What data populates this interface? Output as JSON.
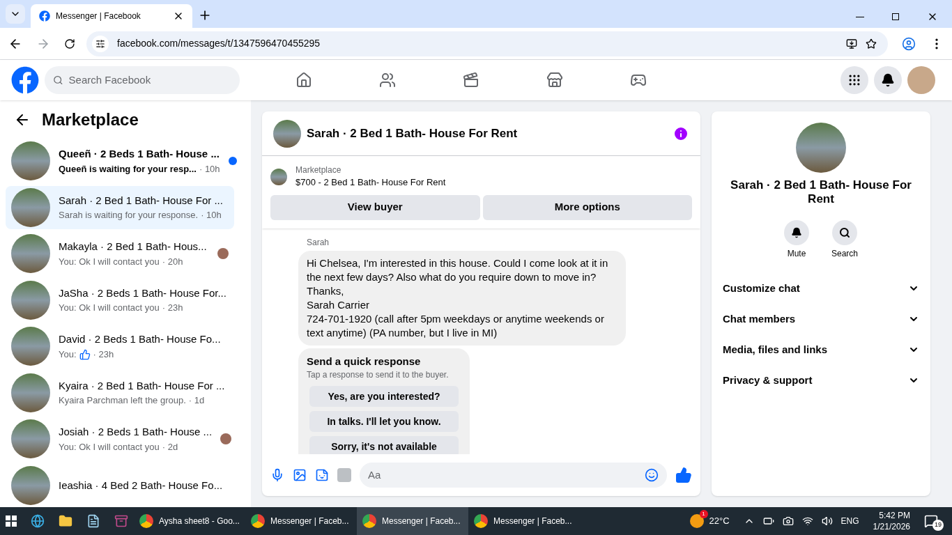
{
  "browser": {
    "tab_title": "Messenger | Facebook",
    "url": "facebook.com/messages/t/1347596470455295"
  },
  "header": {
    "search_placeholder": "Search Facebook"
  },
  "sidebar": {
    "title": "Marketplace",
    "conversations": [
      {
        "name": "Queeñ · 2 Beds 1 Bath- House ...",
        "preview": "Queeñ is waiting for your resp...",
        "time": "· 10h",
        "unread": true,
        "selected": false,
        "seen": false,
        "like": false
      },
      {
        "name": "Sarah · 2 Bed 1 Bath- House For ...",
        "preview": "Sarah is waiting for your response.",
        "time": "· 10h",
        "unread": false,
        "selected": true,
        "seen": false,
        "like": false
      },
      {
        "name": "Makayla · 2 Bed 1 Bath- Hous...",
        "preview": "You: Ok I will contact you",
        "time": "· 20h",
        "unread": false,
        "selected": false,
        "seen": true,
        "like": false
      },
      {
        "name": "JaSha · 2 Beds 1 Bath- House For...",
        "preview": "You: Ok I will contact you",
        "time": "· 23h",
        "unread": false,
        "selected": false,
        "seen": false,
        "like": false
      },
      {
        "name": "David · 2 Beds 1 Bath- House Fo...",
        "preview": "You:",
        "time": "· 23h",
        "unread": false,
        "selected": false,
        "seen": false,
        "like": true
      },
      {
        "name": "Kyaira · 2 Bed 1 Bath- House For ...",
        "preview": "Kyaira Parchman left the group.",
        "time": "· 1d",
        "unread": false,
        "selected": false,
        "seen": false,
        "like": false
      },
      {
        "name": "Josiah · 2 Beds 1 Bath- House ...",
        "preview": "You: Ok I will contact you",
        "time": "· 2d",
        "unread": false,
        "selected": false,
        "seen": true,
        "like": false
      },
      {
        "name": "Ieashia · 4 Bed 2 Bath- House Fo...",
        "unread": false,
        "selected": false,
        "seen": false,
        "like": false
      }
    ]
  },
  "chat": {
    "title": "Sarah · 2 Bed 1 Bath- House For Rent",
    "listing": {
      "label": "Marketplace",
      "title": "$700 - 2 Bed 1 Bath- House For Rent"
    },
    "buttons": [
      "View buyer",
      "More options"
    ],
    "sender": "Sarah",
    "message": "Hi Chelsea, I'm interested in this house. Could I come look at it in the next few days? Also what do you require down to move in?\nThanks,\nSarah Carrier\n724-701-1920 (call after 5pm weekdays or anytime weekends or text anytime) (PA number, but I live in MI)",
    "quick_response": {
      "title": "Send a quick response",
      "subtitle": "Tap a response to send it to the buyer.",
      "options": [
        "Yes, are you interested?",
        "In talks. I'll let you know.",
        "Sorry, it's not available"
      ]
    },
    "composer_placeholder": "Aa"
  },
  "info": {
    "name": "Sarah · 2 Bed 1 Bath- House For Rent",
    "actions": [
      {
        "label": "Mute",
        "kind": "bell"
      },
      {
        "label": "Search",
        "kind": "search"
      }
    ],
    "sections": [
      "Customize chat",
      "Chat members",
      "Media, files and links",
      "Privacy & support"
    ]
  },
  "taskbar": {
    "apps": [
      {
        "label": "Aysha sheet8 - Goo...",
        "selected": false
      },
      {
        "label": "Messenger | Faceb...",
        "selected": false
      },
      {
        "label": "Messenger | Faceb...",
        "selected": true
      },
      {
        "label": "Messenger | Faceb...",
        "selected": false
      }
    ],
    "weather": {
      "badge": "1",
      "temperature": "22°C"
    },
    "language": "ENG",
    "time": "5:42 PM",
    "date": "1/21/2026",
    "notifications": "19"
  }
}
